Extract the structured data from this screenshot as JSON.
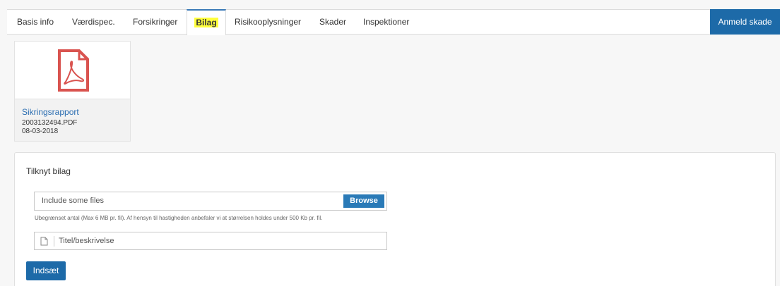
{
  "tabs": [
    {
      "label": "Basis info"
    },
    {
      "label": "Værdispec."
    },
    {
      "label": "Forsikringer"
    },
    {
      "label": "Bilag"
    },
    {
      "label": "Risikooplysninger"
    },
    {
      "label": "Skader"
    },
    {
      "label": "Inspektioner"
    }
  ],
  "active_tab": "Bilag",
  "report_button": "Anmeld skade",
  "file": {
    "name": "Sikringsrapport",
    "filename": "2003132494.PDF",
    "date": "08-03-2018",
    "icon": "pdf-file-icon"
  },
  "attach": {
    "title": "Tilknyt bilag",
    "file_placeholder": "Include some files",
    "browse_label": "Browse",
    "hint": "Ubegrænset antal (Max 6 MB pr. fil). Af hensyn til hastigheden anbefaler vi at størrelsen holdes under 500 Kb pr. fil.",
    "title_placeholder": "Titel/beskrivelse",
    "insert_label": "Indsæt"
  },
  "colors": {
    "primary": "#1d6aa8",
    "link": "#2a6db1",
    "pdf_red": "#d9534f",
    "highlight": "#ffff3d"
  }
}
